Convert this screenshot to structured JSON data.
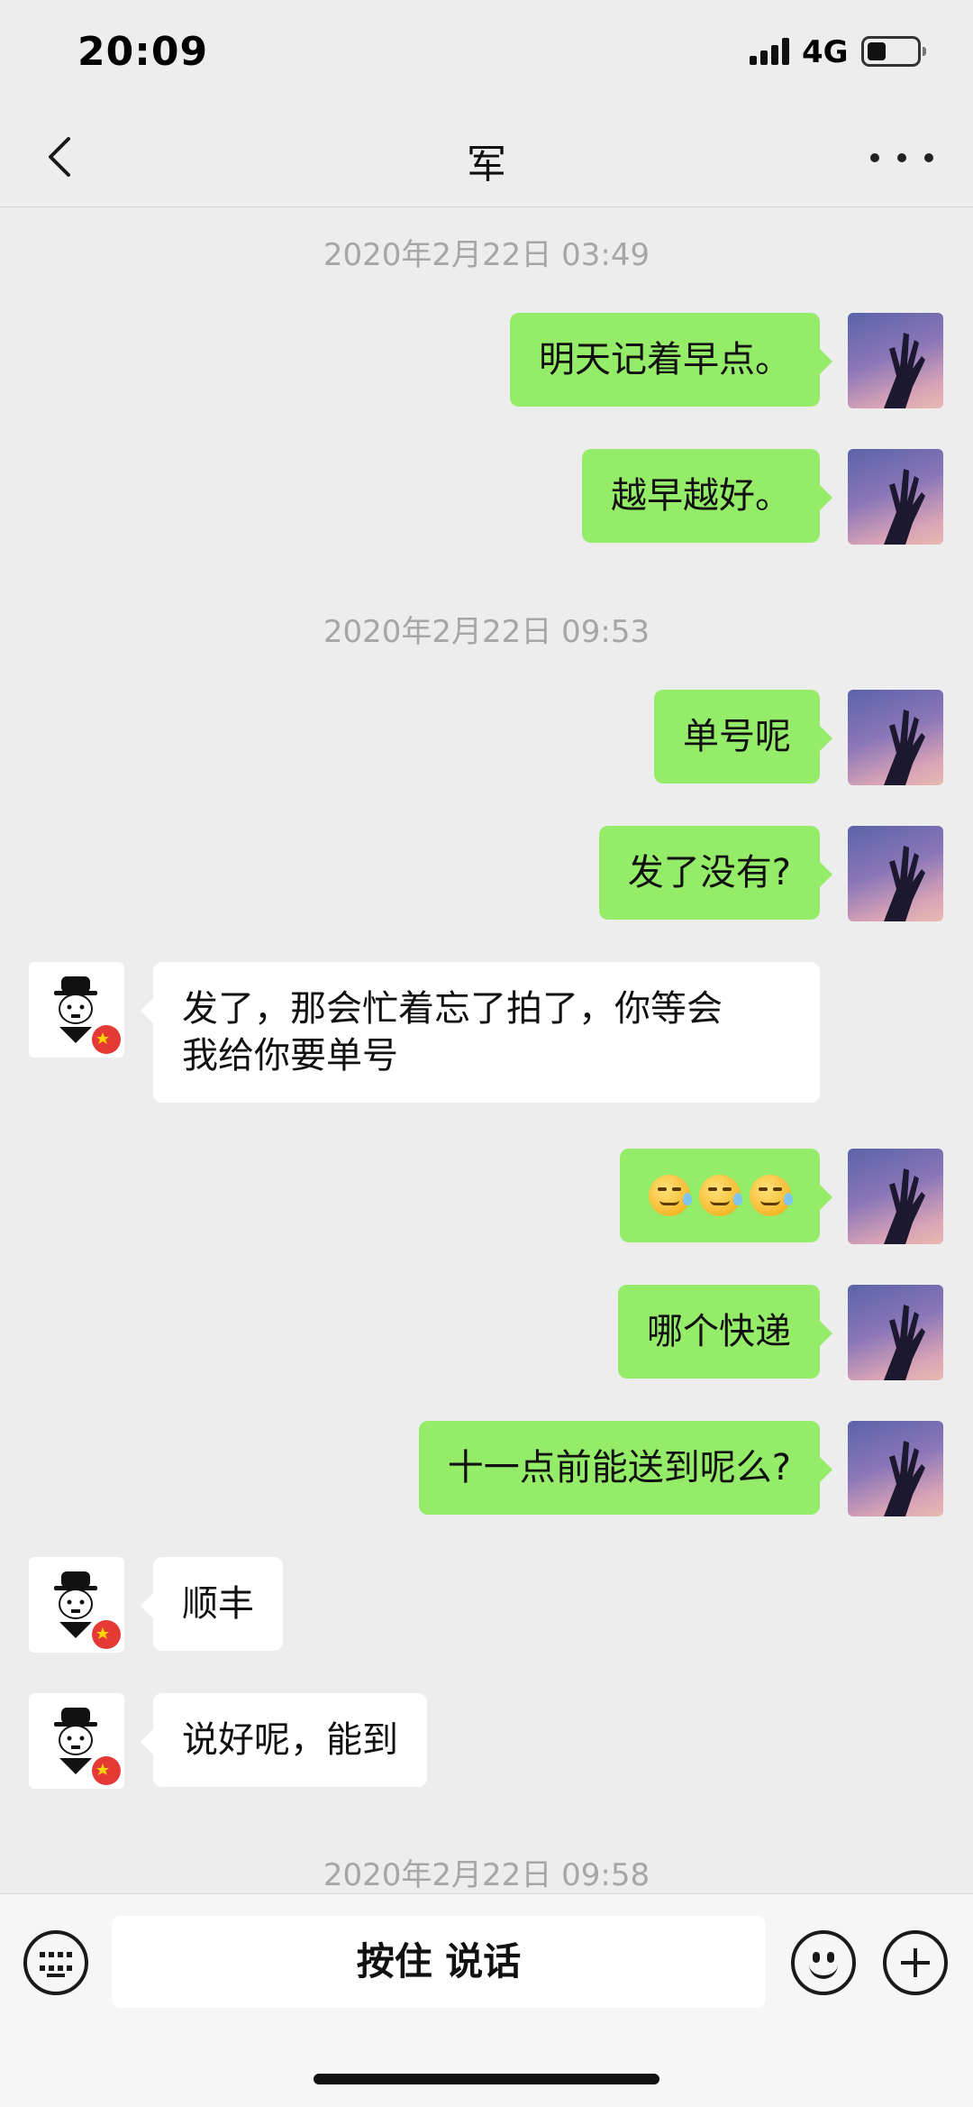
{
  "status_bar": {
    "time": "20:09",
    "network": "4G"
  },
  "nav": {
    "title": "军"
  },
  "timestamps": [
    "2020年2月22日 03:49",
    "2020年2月22日 09:53",
    "2020年2月22日 09:58"
  ],
  "messages": [
    {
      "sender": "me",
      "text": "明天记着早点。"
    },
    {
      "sender": "me",
      "text": "越早越好。"
    },
    {
      "sender": "me",
      "text": "单号呢"
    },
    {
      "sender": "me",
      "text": "发了没有?"
    },
    {
      "sender": "other",
      "line1": "发了，那会忙着忘了拍了，你等会",
      "line2": "我给你要单号"
    },
    {
      "sender": "me",
      "emoji": "sweat-smile-emoji",
      "emoji_count": 3
    },
    {
      "sender": "me",
      "text": "哪个快递"
    },
    {
      "sender": "me",
      "text": "十一点前能送到呢么?"
    },
    {
      "sender": "other",
      "text": "顺丰"
    },
    {
      "sender": "other",
      "text": "说好呢，能到"
    }
  ],
  "input_bar": {
    "voice_label": "按住 说话"
  },
  "icons": {
    "back": "chevron-left-icon",
    "more": "more-dots-icon",
    "keyboard": "keyboard-icon",
    "emoji": "smiley-icon",
    "plus": "plus-icon"
  },
  "colors": {
    "my_bubble": "#95ec69",
    "their_bubble": "#ffffff",
    "background": "#ededed",
    "timestamp": "#a6a6a6"
  }
}
